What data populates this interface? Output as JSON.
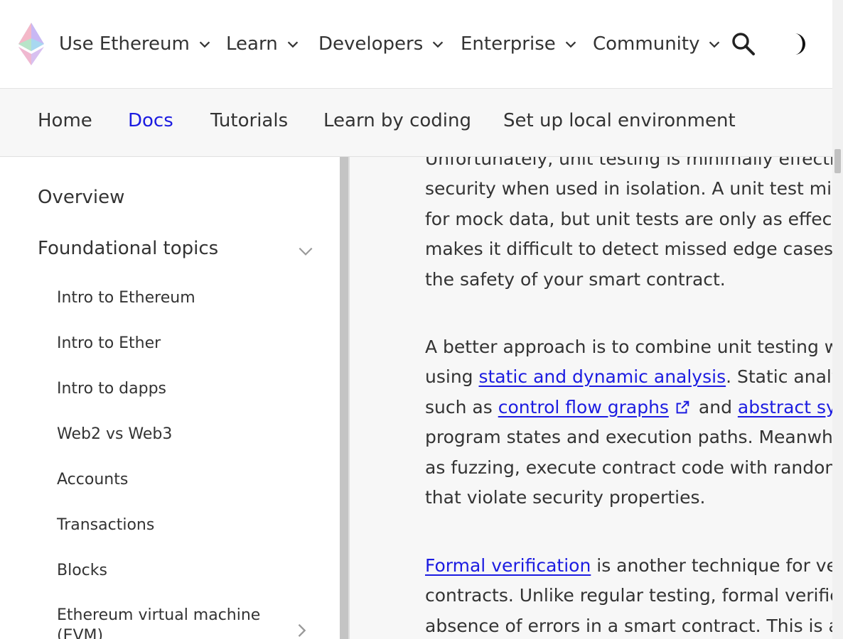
{
  "topnav": {
    "items": [
      {
        "label": "Use Ethereum"
      },
      {
        "label": "Learn"
      },
      {
        "label": "Developers"
      },
      {
        "label": "Enterprise"
      },
      {
        "label": "Community"
      }
    ]
  },
  "subnav": {
    "items": [
      {
        "label": "Home"
      },
      {
        "label": "Docs"
      },
      {
        "label": "Tutorials"
      },
      {
        "label": "Learn by coding"
      },
      {
        "label": "Set up local environment"
      }
    ],
    "active": "Docs"
  },
  "sidebar": {
    "overview": "Overview",
    "group_label": "Foundational topics",
    "items": [
      {
        "label": "Intro to Ethereum"
      },
      {
        "label": "Intro to Ether"
      },
      {
        "label": "Intro to dapps"
      },
      {
        "label": "Web2 vs Web3"
      },
      {
        "label": "Accounts"
      },
      {
        "label": "Transactions"
      },
      {
        "label": "Blocks"
      },
      {
        "label": "Ethereum virtual machine"
      },
      {
        "label": "(EVM)"
      }
    ]
  },
  "content": {
    "p1": [
      "Unfortunately, unit testing is minimally effectiv",
      "security when used in isolation. A unit test mig",
      "for mock data, but unit tests are only as effect",
      "makes it difficult to detect missed edge cases",
      "the safety of your smart contract."
    ],
    "p2": {
      "l1": "A better approach is to combine unit testing w",
      "l2_pre": "using ",
      "l2_link": "static and dynamic analysis",
      "l2_post": ". Static analy",
      "l3_pre": "such as ",
      "l3_link": "control flow graphs",
      "l3_mid": " and ",
      "l3_link2": "abstract sy",
      "l4": "program states and execution paths. Meanwhi",
      "l5": "as fuzzing, execute contract code with randon",
      "l6": "that violate security properties."
    },
    "p3": {
      "l1_link": "Formal verification",
      "l1_post": " is another technique for ver",
      "l2": "contracts. Unlike regular testing, formal verific",
      "l3": "absence of errors in a smart contract. This is a"
    }
  },
  "colors": {
    "link": "#1c1ce1",
    "text": "#333333"
  }
}
